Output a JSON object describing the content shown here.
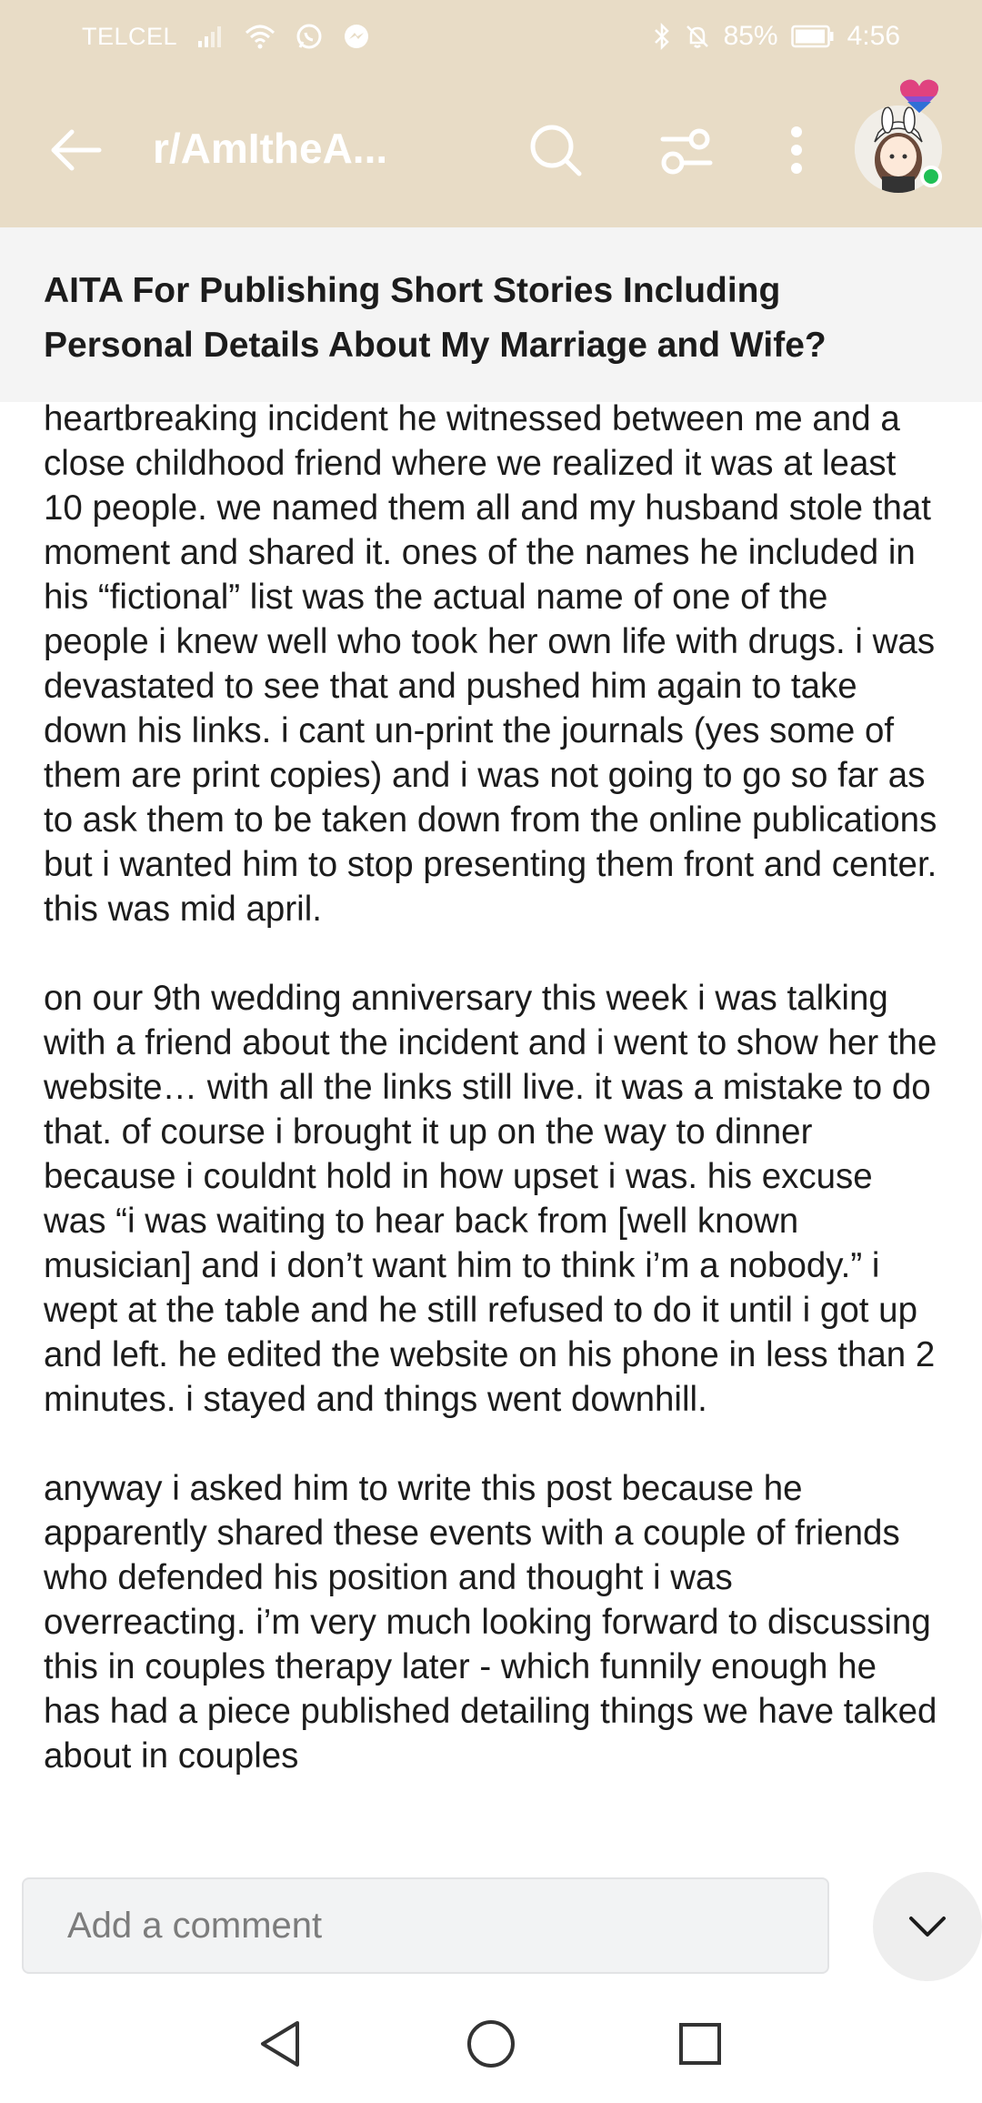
{
  "status_bar": {
    "carrier": "TELCEL",
    "battery": "85%",
    "time": "4:56",
    "icons": [
      "signal-icon",
      "wifi-icon",
      "whatsapp-icon",
      "messenger-icon",
      "bluetooth-icon",
      "mute-icon",
      "battery-icon"
    ]
  },
  "app_bar": {
    "title": "r/AmItheA...",
    "icons": [
      "back-arrow-icon",
      "search-icon",
      "filter-icon",
      "more-vertical-icon",
      "avatar"
    ]
  },
  "post": {
    "title": "AITA For Publishing Short Stories Including Personal Details About My Marriage and Wife?",
    "paragraphs": [
      "heartbreaking incident he witnessed between me and a close childhood friend where we realized it was at least 10 people. we named them all and my husband stole that moment and shared it. ones of the names he included in his “fictional” list was the actual name of one of the people i knew well who took her own life with drugs. i was devastated to see that and pushed him again to take down his links. i cant un-print the journals (yes some of them are print copies) and i was not going to go so far as to ask them to be taken down from the online publications but i wanted him to stop presenting them front and center. this was mid april.",
      "on our 9th wedding anniversary this week i was talking with a friend about the incident and i went to show her the website… with all the links still live. it was a mistake to do that. of course i brought it up on the way to dinner because i couldnt hold in how upset i was. his excuse was “i was waiting to hear back from [well known musician] and i don’t want him to think i’m a nobody.” i wept at the table and he still refused to do it until i got up and left. he edited the website on his phone in less than 2 minutes. i stayed and things went downhill.",
      "anyway i asked him to write this post because he apparently shared these events with a couple of friends who defended his position and thought i was overreacting. i’m very much looking forward to discussing this in couples therapy later - which funnily enough he has had a piece published detailing things we have talked about in couples"
    ]
  },
  "comment_bar": {
    "placeholder": "Add a comment",
    "icons": [
      "chevron-down-icon"
    ]
  },
  "nav_bar": {
    "icons": [
      "back-triangle-icon",
      "home-circle-icon",
      "recents-square-icon"
    ]
  },
  "colors": {
    "header_bg": "#e8dcc6",
    "title_bg": "#f4f4f4",
    "online": "#1fbf55"
  }
}
